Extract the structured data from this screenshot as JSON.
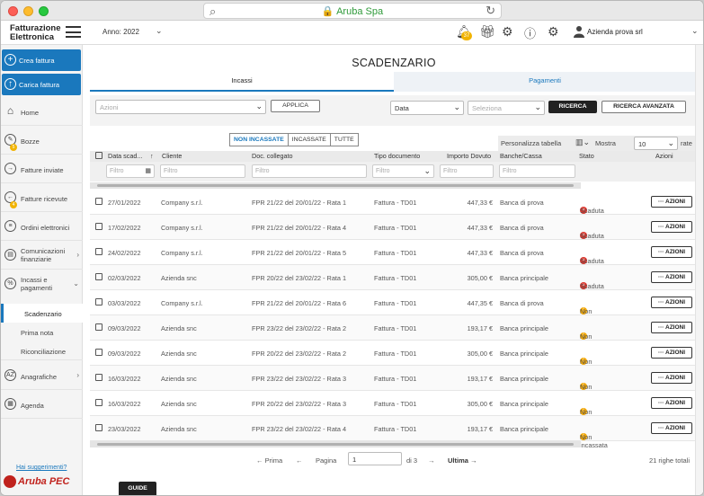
{
  "browser": {
    "site": "Aruba Spa"
  },
  "header": {
    "brand_line1": "Fatturazione",
    "brand_line2": "Elettronica",
    "year_label": "Anno: 2022",
    "notif_count": "37",
    "user_name": "Azienda prova srl"
  },
  "sidebar": {
    "create_invoice": "Crea fattura",
    "upload_invoice": "Carica fattura",
    "items": [
      {
        "label": "Home"
      },
      {
        "label": "Bozze",
        "badge": "5"
      },
      {
        "label": "Fatture inviate"
      },
      {
        "label": "Fatture ricevute",
        "badge": "4"
      },
      {
        "label": "Ordini elettronici"
      },
      {
        "label1": "Comunicazioni",
        "label2": "finanziarie"
      },
      {
        "label1": "Incassi e",
        "label2": "pagamenti"
      },
      {
        "label": "Anagrafiche"
      },
      {
        "label": "Agenda"
      }
    ],
    "subitems": [
      "Scadenzario",
      "Prima nota",
      "Riconciliazione"
    ],
    "suggestions": "Hai suggerimenti?",
    "logo_text": "Aruba PEC"
  },
  "main": {
    "title": "SCADENZARIO",
    "tabs": [
      "Incassi",
      "Pagamenti"
    ],
    "actions_placeholder": "Azioni",
    "apply_label": "APPLICA",
    "date_value": "Data",
    "select_placeholder": "Seleziona",
    "search_label": "RICERCA",
    "advanced_search_label": "RICERCA AVANZATA",
    "segments": [
      "NON INCASSATE",
      "INCASSATE",
      "TUTTE"
    ],
    "customize_label": "Personalizza tabella",
    "show_label": "Mostra",
    "page_size": "10",
    "rate_label": "rate",
    "filter_placeholder": "Filtro",
    "columns": [
      "Data scad...",
      "Cliente",
      "Doc. collegato",
      "Tipo documento",
      "Importo Dovuto",
      "Banche/Cassa",
      "Stato",
      "Azioni"
    ],
    "sort_icon": "↑",
    "rows": [
      {
        "date": "27/01/2022",
        "client": "Company s.r.l.",
        "doc": "FPR 21/22 del 20/01/22 - Rata 1",
        "type": "Fattura - TD01",
        "amount": "447,33 €",
        "bank": "Banca di prova",
        "status": "Scaduta",
        "status_color": "#d9352c"
      },
      {
        "date": "17/02/2022",
        "client": "Company s.r.l.",
        "doc": "FPR 21/22 del 20/01/22 - Rata 4",
        "type": "Fattura - TD01",
        "amount": "447,33 €",
        "bank": "Banca di prova",
        "status": "Scaduta",
        "status_color": "#d9352c"
      },
      {
        "date": "24/02/2022",
        "client": "Company s.r.l.",
        "doc": "FPR 21/22 del 20/01/22 - Rata 5",
        "type": "Fattura - TD01",
        "amount": "447,33 €",
        "bank": "Banca di prova",
        "status": "Scaduta",
        "status_color": "#d9352c"
      },
      {
        "date": "02/03/2022",
        "client": "Azienda snc",
        "doc": "FPR 20/22 del 23/02/22 - Rata 1",
        "type": "Fattura - TD01",
        "amount": "305,00 €",
        "bank": "Banca principale",
        "status": "Scaduta",
        "status_color": "#d9352c"
      },
      {
        "date": "03/03/2022",
        "client": "Company s.r.l.",
        "doc": "FPR 21/22 del 20/01/22 - Rata 6",
        "type": "Fattura - TD01",
        "amount": "447,35 €",
        "bank": "Banca di prova",
        "status": "Non incassata",
        "status_color": "#f2a600"
      },
      {
        "date": "09/03/2022",
        "client": "Azienda snc",
        "doc": "FPR 23/22 del 23/02/22 - Rata 2",
        "type": "Fattura - TD01",
        "amount": "193,17 €",
        "bank": "Banca principale",
        "status": "Non incassata",
        "status_color": "#f2a600"
      },
      {
        "date": "09/03/2022",
        "client": "Azienda snc",
        "doc": "FPR 20/22 del 23/02/22 - Rata 2",
        "type": "Fattura - TD01",
        "amount": "305,00 €",
        "bank": "Banca principale",
        "status": "Non incassata",
        "status_color": "#f2a600"
      },
      {
        "date": "16/03/2022",
        "client": "Azienda snc",
        "doc": "FPR 23/22 del 23/02/22 - Rata 3",
        "type": "Fattura - TD01",
        "amount": "193,17 €",
        "bank": "Banca principale",
        "status": "Non incassata",
        "status_color": "#f2a600"
      },
      {
        "date": "16/03/2022",
        "client": "Azienda snc",
        "doc": "FPR 20/22 del 23/02/22 - Rata 3",
        "type": "Fattura - TD01",
        "amount": "305,00 €",
        "bank": "Banca principale",
        "status": "Non incassata",
        "status_color": "#f2a600"
      },
      {
        "date": "23/03/2022",
        "client": "Azienda snc",
        "doc": "FPR 23/22 del 23/02/22 - Rata 4",
        "type": "Fattura - TD01",
        "amount": "193,17 €",
        "bank": "Banca principale",
        "status": "Non incassata",
        "status_color": "#f2a600"
      }
    ],
    "row_action": "··· AZIONI",
    "pager": {
      "first": "← Prima",
      "prev": "←",
      "page_label": "Pagina",
      "page_value": "1",
      "of_label": "di 3",
      "next": "→",
      "last": "Ultima →",
      "total": "21 righe totali"
    },
    "guide_label": "GUIDE"
  },
  "colors": {
    "accent": "#1a78bd",
    "danger": "#d9352c",
    "warning": "#f2a600"
  }
}
